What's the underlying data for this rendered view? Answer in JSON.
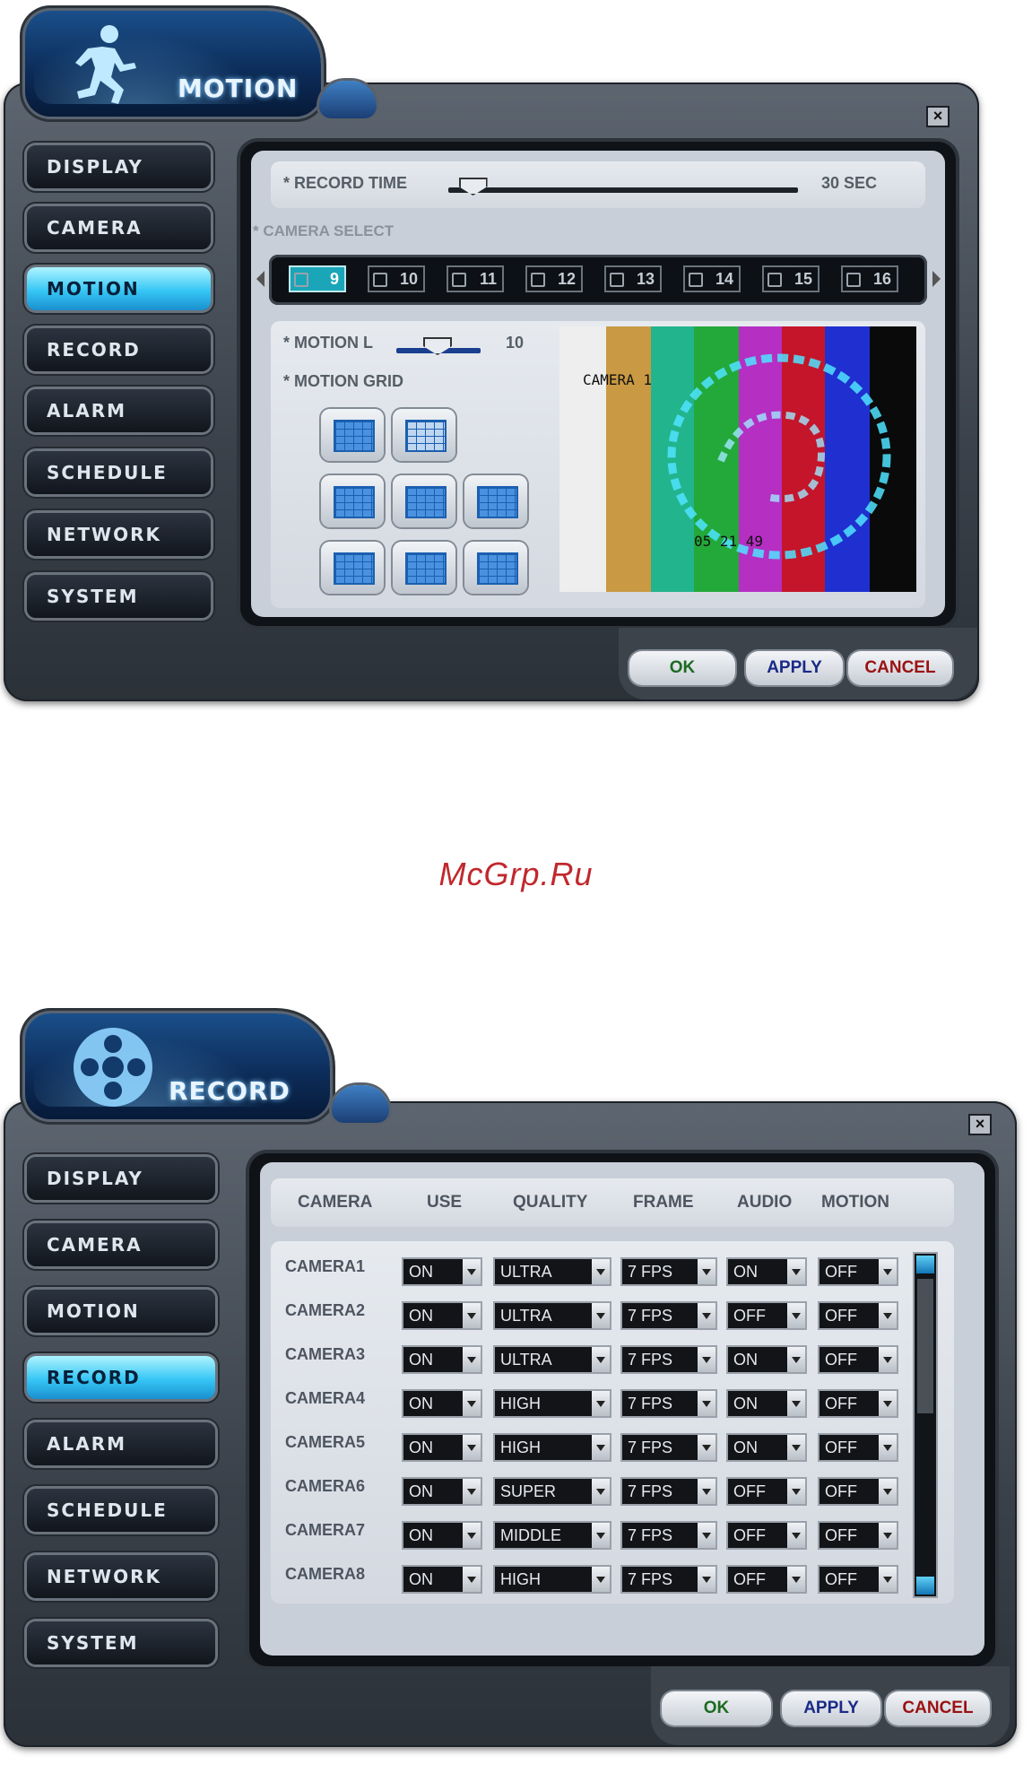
{
  "watermark": "McGrp.Ru",
  "motion_window": {
    "title": "MOTION",
    "nav": [
      "DISPLAY",
      "CAMERA",
      "MOTION",
      "RECORD",
      "ALARM",
      "SCHEDULE",
      "NETWORK",
      "SYSTEM"
    ],
    "active_nav": "MOTION",
    "record_time_label": "* RECORD TIME",
    "record_time_value": "30 SEC",
    "record_time_level": 0.04,
    "camera_select_label": "* CAMERA SELECT",
    "cameras": [
      "9",
      "10",
      "11",
      "12",
      "13",
      "14",
      "15",
      "16"
    ],
    "selected_camera": "9",
    "motion_level_label": "* MOTION L",
    "motion_level_value": "10",
    "motion_grid_label": "* MOTION GRID",
    "preview_camera_label": "CAMERA 1",
    "preview_time": "05 21 49",
    "buttons": {
      "ok": "OK",
      "apply": "APPLY",
      "cancel": "CANCEL"
    },
    "colors": {
      "ok": "#1d6b22",
      "apply": "#1a2a86",
      "cancel": "#9a1212",
      "accent": "#36c6f5"
    }
  },
  "record_window": {
    "title": "RECORD",
    "nav": [
      "DISPLAY",
      "CAMERA",
      "MOTION",
      "RECORD",
      "ALARM",
      "SCHEDULE",
      "NETWORK",
      "SYSTEM"
    ],
    "active_nav": "RECORD",
    "columns": [
      "CAMERA",
      "USE",
      "QUALITY",
      "FRAME",
      "AUDIO",
      "MOTION"
    ],
    "rows": [
      {
        "camera": "CAMERA1",
        "use": "ON",
        "quality": "ULTRA",
        "frame": "7 FPS",
        "audio": "ON",
        "motion": "OFF"
      },
      {
        "camera": "CAMERA2",
        "use": "ON",
        "quality": "ULTRA",
        "frame": "7 FPS",
        "audio": "OFF",
        "motion": "OFF"
      },
      {
        "camera": "CAMERA3",
        "use": "ON",
        "quality": "ULTRA",
        "frame": "7 FPS",
        "audio": "ON",
        "motion": "OFF"
      },
      {
        "camera": "CAMERA4",
        "use": "ON",
        "quality": "HIGH",
        "frame": "7 FPS",
        "audio": "ON",
        "motion": "OFF"
      },
      {
        "camera": "CAMERA5",
        "use": "ON",
        "quality": "HIGH",
        "frame": "7 FPS",
        "audio": "ON",
        "motion": "OFF"
      },
      {
        "camera": "CAMERA6",
        "use": "ON",
        "quality": "SUPER",
        "frame": "7 FPS",
        "audio": "OFF",
        "motion": "OFF"
      },
      {
        "camera": "CAMERA7",
        "use": "ON",
        "quality": "MIDDLE",
        "frame": "7 FPS",
        "audio": "OFF",
        "motion": "OFF"
      },
      {
        "camera": "CAMERA8",
        "use": "ON",
        "quality": "HIGH",
        "frame": "7 FPS",
        "audio": "OFF",
        "motion": "OFF"
      }
    ],
    "buttons": {
      "ok": "OK",
      "apply": "APPLY",
      "cancel": "CANCEL"
    }
  }
}
